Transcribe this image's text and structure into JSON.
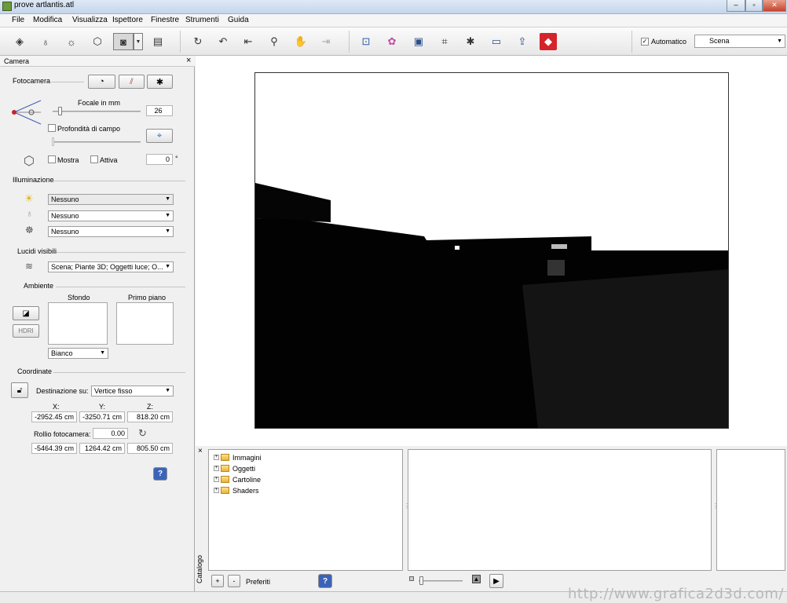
{
  "window": {
    "title": "prove artlantis.atl"
  },
  "menu": [
    "File",
    "Modifica",
    "Visualizza",
    "Ispettore",
    "Finestre",
    "Strumenti",
    "Guida"
  ],
  "toolbar": {
    "auto_label": "Automatico",
    "auto_checked": true,
    "scene_select": "Scena"
  },
  "panel": {
    "title": "Camera",
    "close": "×",
    "fotocamera": "Fotocamera",
    "focale_label": "Focale in mm",
    "focale_value": "26",
    "focale_fraction": 0.06,
    "profondita_label": "Profondità di campo",
    "mostra_label": "Mostra",
    "attiva_label": "Attiva",
    "angle_value": "0",
    "degree_symbol": "°",
    "illuminazione": "Illuminazione",
    "sun_select": "Nessuno",
    "light_select": "Nessuno",
    "heliodon_select": "Nessuno",
    "lucidi_label": "Lucidi visibili",
    "lucidi_value": "Scena; Piante 3D; Oggetti luce; O...",
    "ambiente": "Ambiente",
    "sfondo": "Sfondo",
    "primo_piano": "Primo piano",
    "hdri": "HDRI",
    "bg_select": "Bianco",
    "coordinate": "Coordinate",
    "destinazione_label": "Destinazione su:",
    "destinazione_value": "Vertice fisso",
    "x_label": "X:",
    "y_label": "Y:",
    "z_label": "Z:",
    "x_value": "-2952.45 cm",
    "y_value": "-3250.71 cm",
    "z_value": "818.20 cm",
    "rollio_label": "Rollio fotocamera:",
    "rollio_value": "0.00",
    "x2_value": "-5464.39 cm",
    "y2_value": "1264.42 cm",
    "z2_value": "805.50 cm",
    "help": "?"
  },
  "catalog": {
    "side_label": "Catalogo",
    "close": "×",
    "tree": [
      "Immagini",
      "Oggetti",
      "Cartoline",
      "Shaders"
    ],
    "plus_btn": "+",
    "minus_btn": "-",
    "preferiti": "Preferiti",
    "help": "?"
  },
  "watermark": "http://www.grafica2d3d.com/"
}
